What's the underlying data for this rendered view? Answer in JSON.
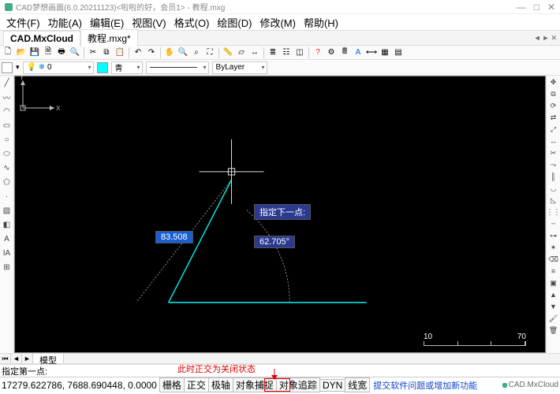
{
  "titlebar": {
    "title": "CAD梦想画面(6.0.20211123)<啦啦的好，会员1> - 教程.mxg"
  },
  "menu": {
    "file": "文件(F)",
    "func": "功能(A)",
    "edit": "编辑(E)",
    "view": "视图(V)",
    "format": "格式(O)",
    "draw": "绘图(D)",
    "modify": "修改(M)",
    "help": "帮助(H)"
  },
  "tabs": {
    "cloud": "CAD.MxCloud",
    "active": "教程.mxg*"
  },
  "props": {
    "layer": "0",
    "color": "青",
    "linetype": "ByLayer"
  },
  "canvas": {
    "length": "83.508",
    "angle": "62.705°",
    "tooltip": "指定下一点:",
    "scale": {
      "a": "10",
      "b": "70"
    },
    "axes": {
      "y": "Y",
      "x": "X"
    }
  },
  "model_tab": "模型",
  "annotation": "此时正交为关闭状态",
  "cmd": {
    "prompt": "指定第一点:"
  },
  "status": {
    "coords": "17279.622786,  7688.690448,  0.0000",
    "snap": "栅格",
    "ortho": "正交",
    "polar": "极轴",
    "osnap": "对象捕捉",
    "otrack": "对象追踪",
    "dyn": "DYN",
    "lwt": "线宽",
    "feedback": "提交软件问题或增加新功能",
    "brand": "CAD.MxCloud"
  }
}
